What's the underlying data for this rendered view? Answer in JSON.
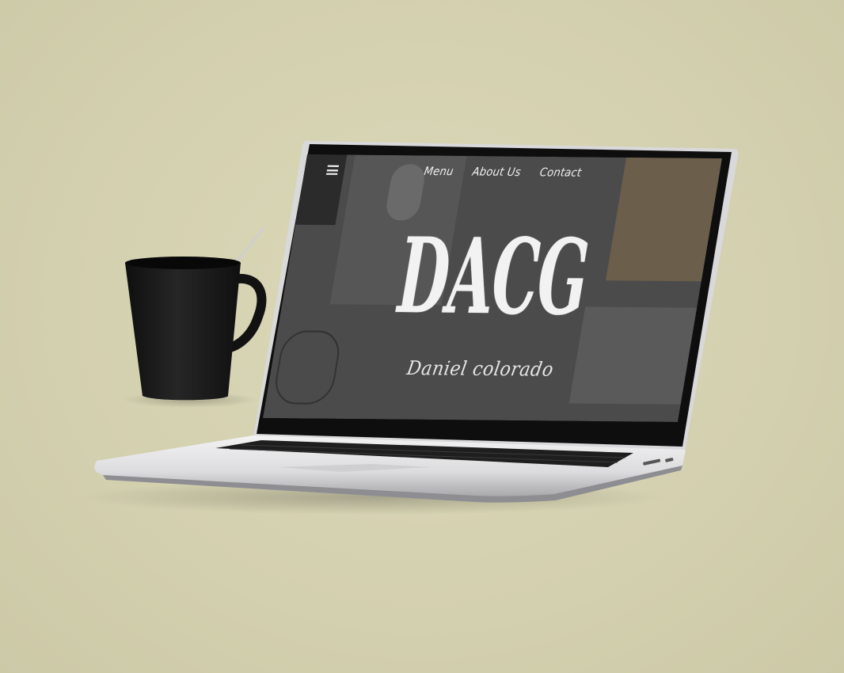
{
  "site": {
    "logo_text": "DACG",
    "subtitle": "Daniel colorado"
  },
  "nav": {
    "items": [
      {
        "label": "Menu"
      },
      {
        "label": "About Us"
      },
      {
        "label": "Contact"
      }
    ]
  },
  "colors": {
    "background": "#d6d3b3",
    "screen_bg": "#4b4b4b",
    "text": "#f2f2f2",
    "mug": "#1b1b1b",
    "laptop_body": "#e6e6e8"
  },
  "icons": [
    "menu-icon"
  ]
}
